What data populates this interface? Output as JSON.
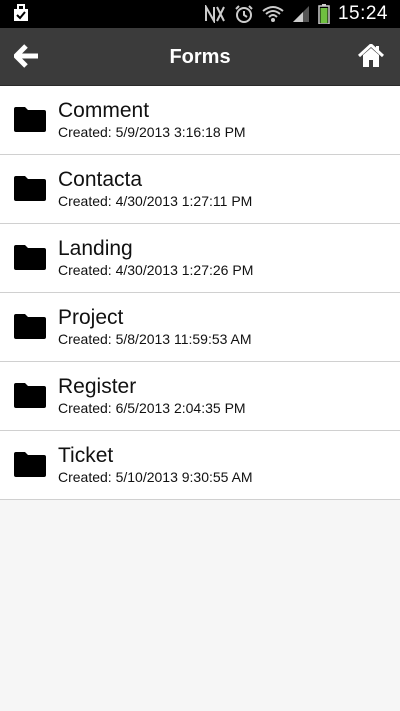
{
  "status_bar": {
    "time": "15:24",
    "icons": [
      "check-bag-icon",
      "nfc-icon",
      "alarm-icon",
      "wifi-icon",
      "signal-icon",
      "battery-icon"
    ]
  },
  "header": {
    "title": "Forms",
    "back_icon": "arrow-left-icon",
    "home_icon": "home-icon"
  },
  "forms": [
    {
      "name": "Comment",
      "created": "Created: 5/9/2013 3:16:18 PM"
    },
    {
      "name": "Contacta",
      "created": "Created: 4/30/2013 1:27:11 PM"
    },
    {
      "name": "Landing",
      "created": "Created: 4/30/2013 1:27:26 PM"
    },
    {
      "name": "Project",
      "created": "Created: 5/8/2013 11:59:53 AM"
    },
    {
      "name": "Register",
      "created": "Created: 6/5/2013 2:04:35 PM"
    },
    {
      "name": "Ticket",
      "created": "Created: 5/10/2013 9:30:55 AM"
    }
  ],
  "colors": {
    "header_bg": "#3b3b3b",
    "status_bg": "#000000",
    "page_bg": "#f6f6f6"
  }
}
